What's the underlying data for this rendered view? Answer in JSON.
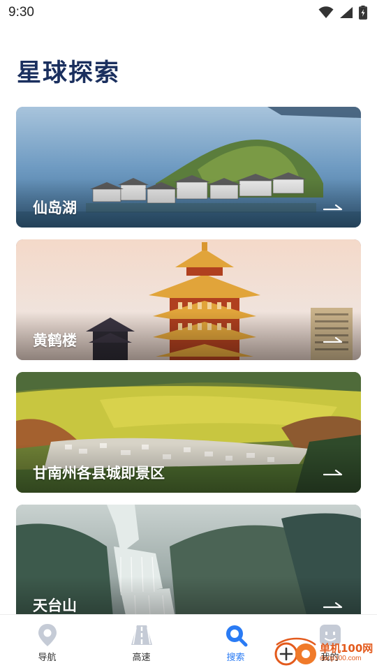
{
  "status_bar": {
    "time": "9:30"
  },
  "page": {
    "title": "星球探索"
  },
  "cards": [
    {
      "label": "仙岛湖"
    },
    {
      "label": "黄鹤楼"
    },
    {
      "label": "甘南州各县城即景区"
    },
    {
      "label": "天台山"
    }
  ],
  "bottom_nav": {
    "items": [
      {
        "label": "导航",
        "icon": "location-pin-icon"
      },
      {
        "label": "高速",
        "icon": "highway-road-icon"
      },
      {
        "label": "搜索",
        "icon": "search-icon",
        "active": true
      },
      {
        "label": "我的",
        "icon": "profile-face-icon"
      }
    ]
  },
  "watermark": {
    "main": "单机100网",
    "sub": "danji100.com"
  },
  "colors": {
    "title": "#1a2f5e",
    "active_nav": "#2a7bf4",
    "inactive_icon": "#c5cbd6"
  }
}
